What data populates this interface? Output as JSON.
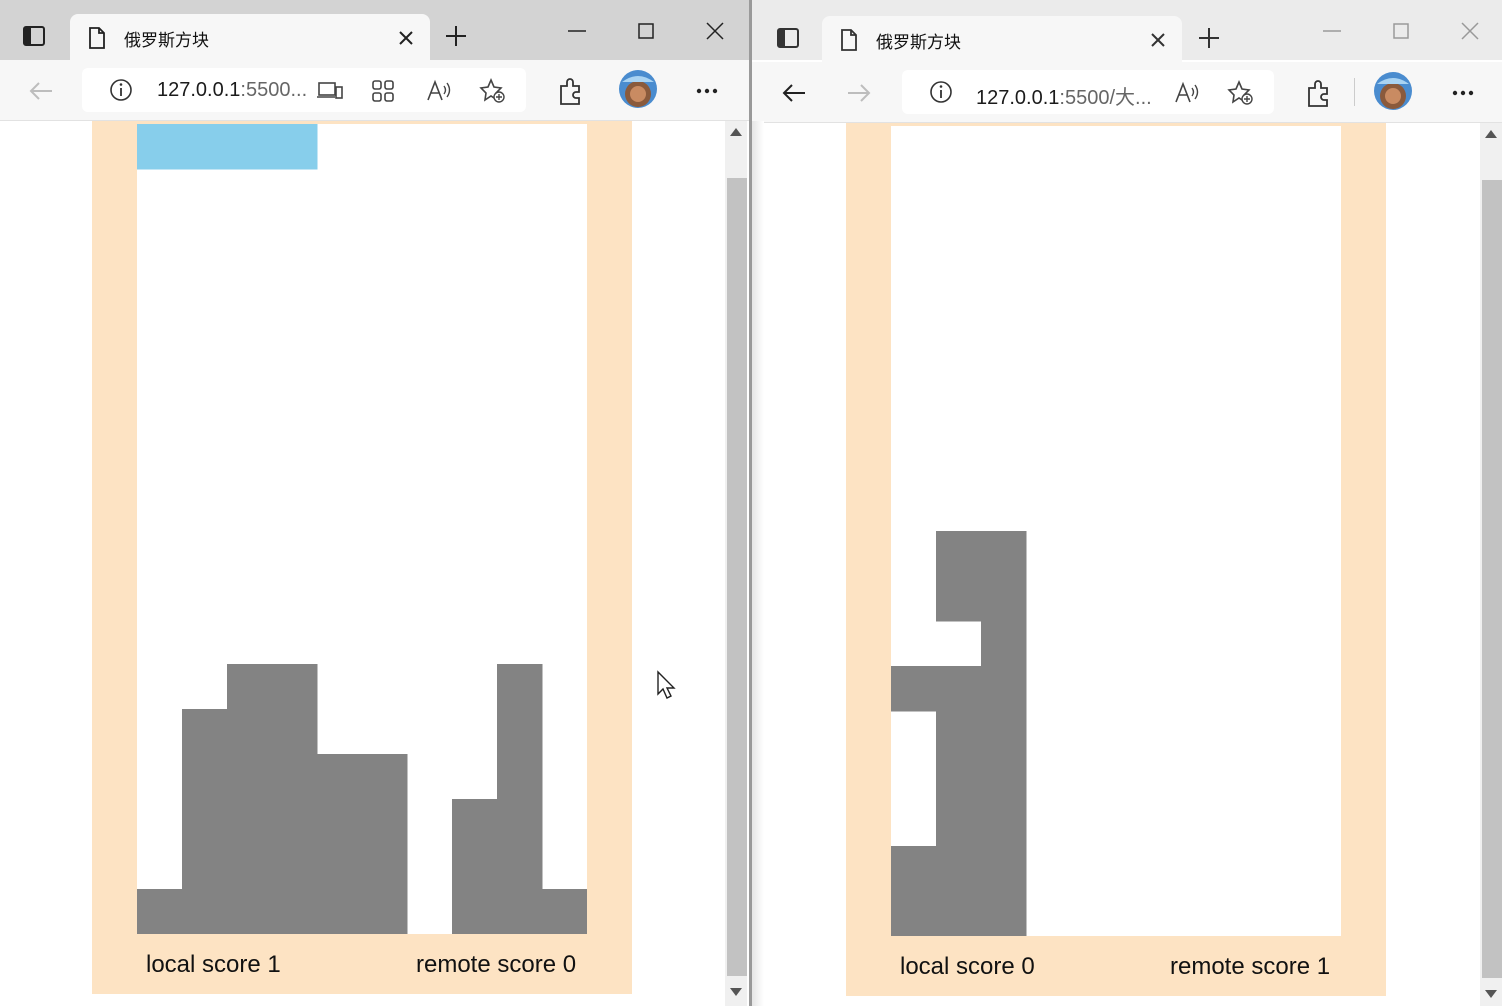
{
  "colors": {
    "frame": "#fde3c3",
    "board": "#ffffff",
    "locked_block": "#838383",
    "active_piece": "#87ceeb",
    "tab_strip_active": "#d3d3d3",
    "tab_strip_inactive": "#ebebeb"
  },
  "left_window": {
    "tab": {
      "title": "俄罗斯方块",
      "page_icon": "page-icon",
      "close_icon": "close-icon"
    },
    "address": {
      "host": "127.0.0.1",
      "rest": ":5500..."
    },
    "icons": [
      "sidebar-icon",
      "new-tab-icon",
      "minimize-icon",
      "maximize-icon",
      "close-window-icon",
      "back-icon",
      "info-icon",
      "device-icon",
      "app-grid-icon",
      "read-aloud-icon",
      "add-favorite-icon",
      "extensions-icon",
      "profile-avatar",
      "more-icon"
    ],
    "game": {
      "columns": 10,
      "rows": 18,
      "locked_cells": [
        [
          12,
          2
        ],
        [
          12,
          3
        ],
        [
          12,
          8
        ],
        [
          13,
          1
        ],
        [
          13,
          2
        ],
        [
          13,
          3
        ],
        [
          13,
          8
        ],
        [
          14,
          1
        ],
        [
          14,
          2
        ],
        [
          14,
          3
        ],
        [
          14,
          4
        ],
        [
          14,
          5
        ],
        [
          14,
          8
        ],
        [
          15,
          1
        ],
        [
          15,
          2
        ],
        [
          15,
          3
        ],
        [
          15,
          4
        ],
        [
          15,
          5
        ],
        [
          15,
          7
        ],
        [
          15,
          8
        ],
        [
          16,
          1
        ],
        [
          16,
          2
        ],
        [
          16,
          3
        ],
        [
          16,
          4
        ],
        [
          16,
          5
        ],
        [
          16,
          7
        ],
        [
          16,
          8
        ],
        [
          17,
          0
        ],
        [
          17,
          1
        ],
        [
          17,
          2
        ],
        [
          17,
          3
        ],
        [
          17,
          4
        ],
        [
          17,
          5
        ],
        [
          17,
          7
        ],
        [
          17,
          8
        ],
        [
          17,
          9
        ]
      ],
      "active_cells": [
        [
          0,
          0
        ],
        [
          0,
          1
        ],
        [
          0,
          2
        ],
        [
          0,
          3
        ]
      ],
      "local_score_label": "local score 1",
      "remote_score_label": "remote score 0"
    }
  },
  "right_window": {
    "tab": {
      "title": "俄罗斯方块",
      "page_icon": "page-icon",
      "close_icon": "close-icon"
    },
    "address": {
      "host": "127.0.0.1",
      "rest": ":5500/大..."
    },
    "icons": [
      "sidebar-icon",
      "new-tab-icon",
      "minimize-icon",
      "maximize-icon",
      "close-window-icon",
      "back-icon",
      "forward-icon",
      "info-icon",
      "read-aloud-icon",
      "add-favorite-icon",
      "extensions-icon",
      "profile-avatar",
      "more-icon"
    ],
    "game": {
      "columns": 10,
      "rows": 18,
      "locked_cells": [
        [
          9,
          1
        ],
        [
          9,
          2
        ],
        [
          10,
          1
        ],
        [
          10,
          2
        ],
        [
          11,
          2
        ],
        [
          12,
          0
        ],
        [
          12,
          1
        ],
        [
          12,
          2
        ],
        [
          13,
          1
        ],
        [
          13,
          2
        ],
        [
          14,
          1
        ],
        [
          14,
          2
        ],
        [
          15,
          1
        ],
        [
          15,
          2
        ],
        [
          16,
          0
        ],
        [
          16,
          1
        ],
        [
          16,
          2
        ],
        [
          17,
          0
        ],
        [
          17,
          1
        ],
        [
          17,
          2
        ]
      ],
      "active_cells": [],
      "local_score_label": "local score 0",
      "remote_score_label": "remote score 1"
    }
  }
}
